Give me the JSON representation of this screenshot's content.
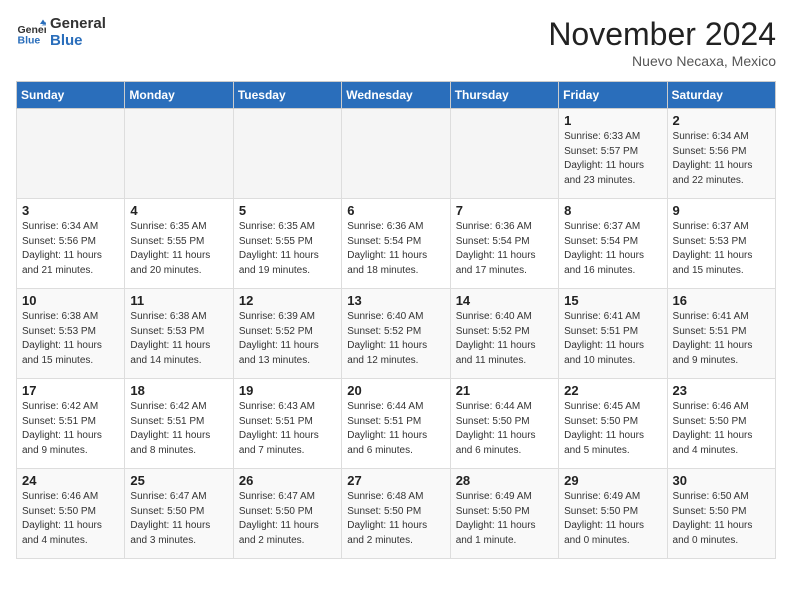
{
  "header": {
    "logo_general": "General",
    "logo_blue": "Blue",
    "month_title": "November 2024",
    "location": "Nuevo Necaxa, Mexico"
  },
  "weekdays": [
    "Sunday",
    "Monday",
    "Tuesday",
    "Wednesday",
    "Thursday",
    "Friday",
    "Saturday"
  ],
  "weeks": [
    [
      {
        "day": "",
        "info": ""
      },
      {
        "day": "",
        "info": ""
      },
      {
        "day": "",
        "info": ""
      },
      {
        "day": "",
        "info": ""
      },
      {
        "day": "",
        "info": ""
      },
      {
        "day": "1",
        "info": "Sunrise: 6:33 AM\nSunset: 5:57 PM\nDaylight: 11 hours and 23 minutes."
      },
      {
        "day": "2",
        "info": "Sunrise: 6:34 AM\nSunset: 5:56 PM\nDaylight: 11 hours and 22 minutes."
      }
    ],
    [
      {
        "day": "3",
        "info": "Sunrise: 6:34 AM\nSunset: 5:56 PM\nDaylight: 11 hours and 21 minutes."
      },
      {
        "day": "4",
        "info": "Sunrise: 6:35 AM\nSunset: 5:55 PM\nDaylight: 11 hours and 20 minutes."
      },
      {
        "day": "5",
        "info": "Sunrise: 6:35 AM\nSunset: 5:55 PM\nDaylight: 11 hours and 19 minutes."
      },
      {
        "day": "6",
        "info": "Sunrise: 6:36 AM\nSunset: 5:54 PM\nDaylight: 11 hours and 18 minutes."
      },
      {
        "day": "7",
        "info": "Sunrise: 6:36 AM\nSunset: 5:54 PM\nDaylight: 11 hours and 17 minutes."
      },
      {
        "day": "8",
        "info": "Sunrise: 6:37 AM\nSunset: 5:54 PM\nDaylight: 11 hours and 16 minutes."
      },
      {
        "day": "9",
        "info": "Sunrise: 6:37 AM\nSunset: 5:53 PM\nDaylight: 11 hours and 15 minutes."
      }
    ],
    [
      {
        "day": "10",
        "info": "Sunrise: 6:38 AM\nSunset: 5:53 PM\nDaylight: 11 hours and 15 minutes."
      },
      {
        "day": "11",
        "info": "Sunrise: 6:38 AM\nSunset: 5:53 PM\nDaylight: 11 hours and 14 minutes."
      },
      {
        "day": "12",
        "info": "Sunrise: 6:39 AM\nSunset: 5:52 PM\nDaylight: 11 hours and 13 minutes."
      },
      {
        "day": "13",
        "info": "Sunrise: 6:40 AM\nSunset: 5:52 PM\nDaylight: 11 hours and 12 minutes."
      },
      {
        "day": "14",
        "info": "Sunrise: 6:40 AM\nSunset: 5:52 PM\nDaylight: 11 hours and 11 minutes."
      },
      {
        "day": "15",
        "info": "Sunrise: 6:41 AM\nSunset: 5:51 PM\nDaylight: 11 hours and 10 minutes."
      },
      {
        "day": "16",
        "info": "Sunrise: 6:41 AM\nSunset: 5:51 PM\nDaylight: 11 hours and 9 minutes."
      }
    ],
    [
      {
        "day": "17",
        "info": "Sunrise: 6:42 AM\nSunset: 5:51 PM\nDaylight: 11 hours and 9 minutes."
      },
      {
        "day": "18",
        "info": "Sunrise: 6:42 AM\nSunset: 5:51 PM\nDaylight: 11 hours and 8 minutes."
      },
      {
        "day": "19",
        "info": "Sunrise: 6:43 AM\nSunset: 5:51 PM\nDaylight: 11 hours and 7 minutes."
      },
      {
        "day": "20",
        "info": "Sunrise: 6:44 AM\nSunset: 5:51 PM\nDaylight: 11 hours and 6 minutes."
      },
      {
        "day": "21",
        "info": "Sunrise: 6:44 AM\nSunset: 5:50 PM\nDaylight: 11 hours and 6 minutes."
      },
      {
        "day": "22",
        "info": "Sunrise: 6:45 AM\nSunset: 5:50 PM\nDaylight: 11 hours and 5 minutes."
      },
      {
        "day": "23",
        "info": "Sunrise: 6:46 AM\nSunset: 5:50 PM\nDaylight: 11 hours and 4 minutes."
      }
    ],
    [
      {
        "day": "24",
        "info": "Sunrise: 6:46 AM\nSunset: 5:50 PM\nDaylight: 11 hours and 4 minutes."
      },
      {
        "day": "25",
        "info": "Sunrise: 6:47 AM\nSunset: 5:50 PM\nDaylight: 11 hours and 3 minutes."
      },
      {
        "day": "26",
        "info": "Sunrise: 6:47 AM\nSunset: 5:50 PM\nDaylight: 11 hours and 2 minutes."
      },
      {
        "day": "27",
        "info": "Sunrise: 6:48 AM\nSunset: 5:50 PM\nDaylight: 11 hours and 2 minutes."
      },
      {
        "day": "28",
        "info": "Sunrise: 6:49 AM\nSunset: 5:50 PM\nDaylight: 11 hours and 1 minute."
      },
      {
        "day": "29",
        "info": "Sunrise: 6:49 AM\nSunset: 5:50 PM\nDaylight: 11 hours and 0 minutes."
      },
      {
        "day": "30",
        "info": "Sunrise: 6:50 AM\nSunset: 5:50 PM\nDaylight: 11 hours and 0 minutes."
      }
    ]
  ]
}
